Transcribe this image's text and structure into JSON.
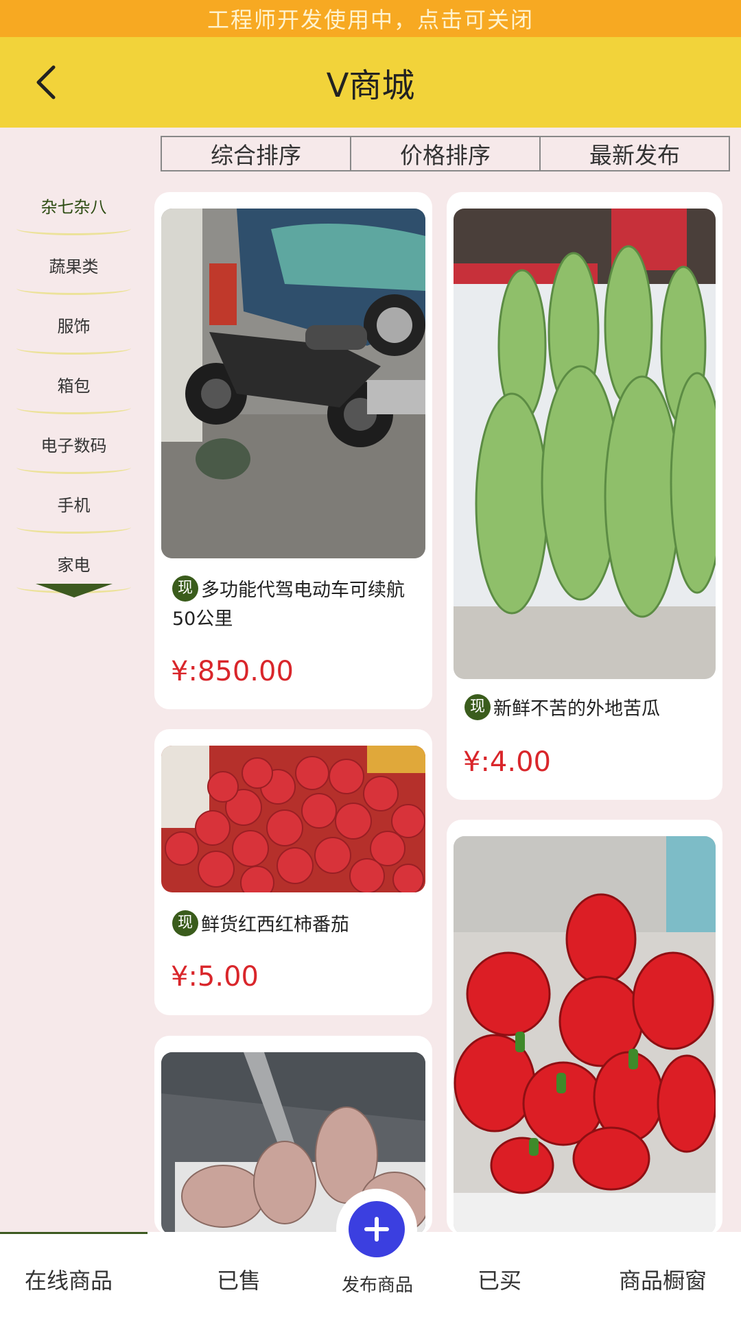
{
  "dev_bar": {
    "text": "工程师开发使用中，点击可关闭"
  },
  "header": {
    "title": "V商城"
  },
  "sort_tabs": [
    "综合排序",
    "价格排序",
    "最新发布"
  ],
  "categories": [
    "杂七杂八",
    "蔬果类",
    "服饰",
    "箱包",
    "电子数码",
    "手机",
    "家电"
  ],
  "products": [
    {
      "badge": "现",
      "title": "多功能代驾电动车可续航50公里",
      "price": "¥:850.00",
      "image": "electric scooter parked by car"
    },
    {
      "badge": "现",
      "title": "新鲜不苦的外地苦瓜",
      "price": "¥:4.00",
      "image": "bitter melons"
    },
    {
      "badge": "现",
      "title": "鲜货红西红柿番茄",
      "price": "¥:5.00",
      "image": "red tomatoes"
    },
    {
      "badge": "",
      "title": "",
      "price": "",
      "image": "radishes in crate"
    },
    {
      "badge": "",
      "title": "",
      "price": "",
      "image": "red bell peppers"
    }
  ],
  "bottom_nav": {
    "online": "在线商品",
    "sold": "已售",
    "publish": "发布商品",
    "bought": "已买",
    "showcase": "商品橱窗"
  },
  "colors": {
    "dev_bar": "#f7a922",
    "header": "#f2d33a",
    "price": "#d9262b",
    "badge": "#3a5c1c",
    "publish_button": "#3b3fe0"
  }
}
